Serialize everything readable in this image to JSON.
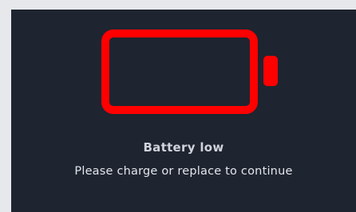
{
  "screen": {
    "background": "#1e2430",
    "frame_background": "#e6e8eb"
  },
  "battery": {
    "icon": "battery-empty-icon",
    "color": "#ff0000",
    "level_percent": 0
  },
  "status": {
    "title": "Battery low",
    "message": "Please charge or replace to continue",
    "title_color": "#cfd3da",
    "message_color": "#e2e5ea"
  }
}
